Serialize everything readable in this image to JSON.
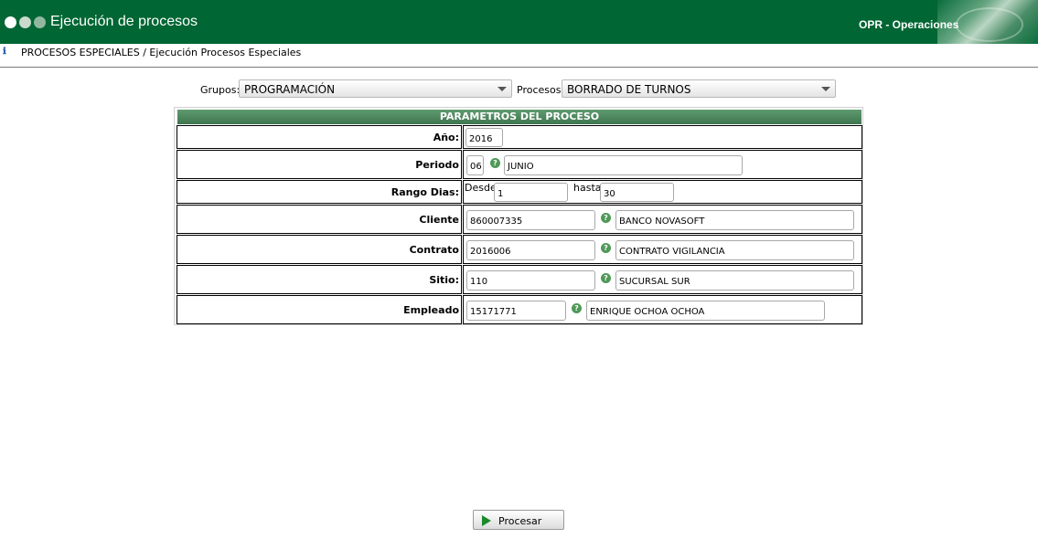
{
  "header": {
    "title": "Ejecución de procesos",
    "module": "OPR - Operaciones",
    "dot_colors": [
      "#ffffff",
      "#c8dbcc",
      "#91b89f"
    ]
  },
  "breadcrumb": "PROCESOS ESPECIALES / Ejecución Procesos Especiales",
  "filters": {
    "grupos_label": "Grupos:",
    "grupos_value": "PROGRAMACIÓN",
    "procesos_label": "Procesos:",
    "procesos_value": "BORRADO DE TURNOS"
  },
  "panel": {
    "title": "PARAMETROS DEL PROCESO",
    "anio_label": "Año:",
    "anio_value": "2016",
    "periodo_label": "Periodo",
    "periodo_code": "06",
    "periodo_name": "JUNIO",
    "rango_label": "Rango Dias:",
    "desde_label": "Desde",
    "desde_value": "1",
    "hasta_label": "hasta",
    "hasta_value": "30",
    "cliente_label": "Cliente",
    "cliente_code": "860007335",
    "cliente_name": "BANCO NOVASOFT",
    "contrato_label": "Contrato",
    "contrato_code": "2016006",
    "contrato_name": "CONTRATO VIGILANCIA",
    "sitio_label": "Sitio:",
    "sitio_code": "110",
    "sitio_name": "SUCURSAL SUR",
    "empleado_label": "Empleado",
    "empleado_code": "15171771",
    "empleado_name": "ENRIQUE OCHOA OCHOA"
  },
  "actions": {
    "procesar_label": "Procesar"
  }
}
